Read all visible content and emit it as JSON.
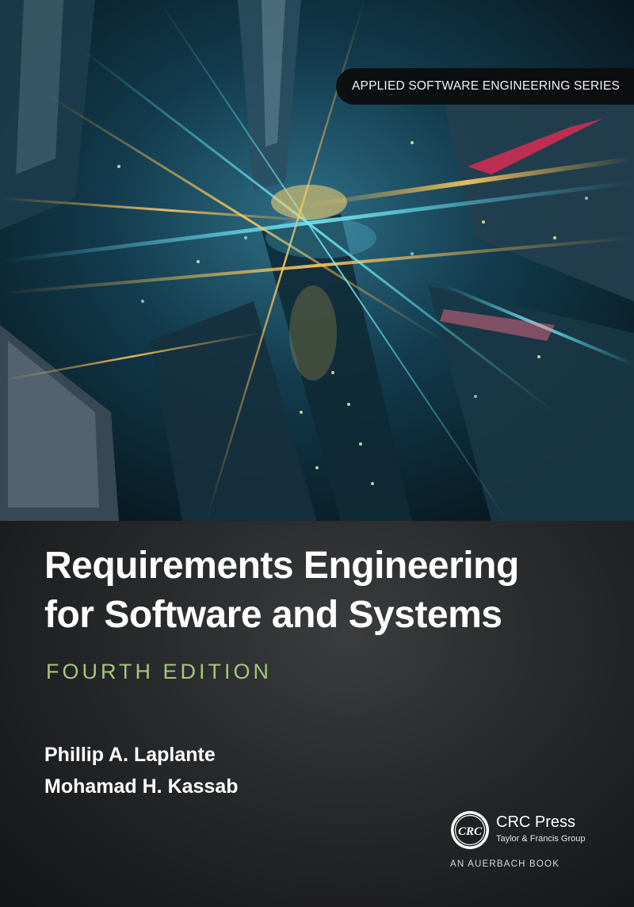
{
  "series": "APPLIED SOFTWARE ENGINEERING SERIES",
  "title_line1": "Requirements Engineering",
  "title_line2": "for Software and Systems",
  "edition": "FOURTH EDITION",
  "authors": [
    "Phillip A. Laplante",
    "Mohamad H. Kassab"
  ],
  "publisher": {
    "logo_text": "CRC",
    "name": "CRC Press",
    "group": "Taylor & Francis Group",
    "imprint": "AN AUERBACH BOOK"
  },
  "colors": {
    "edition": "#a6c77a",
    "panel": "#2a2b2d",
    "banner": "#0c0c0c"
  },
  "icons": [
    "crc-press-logo-icon"
  ]
}
